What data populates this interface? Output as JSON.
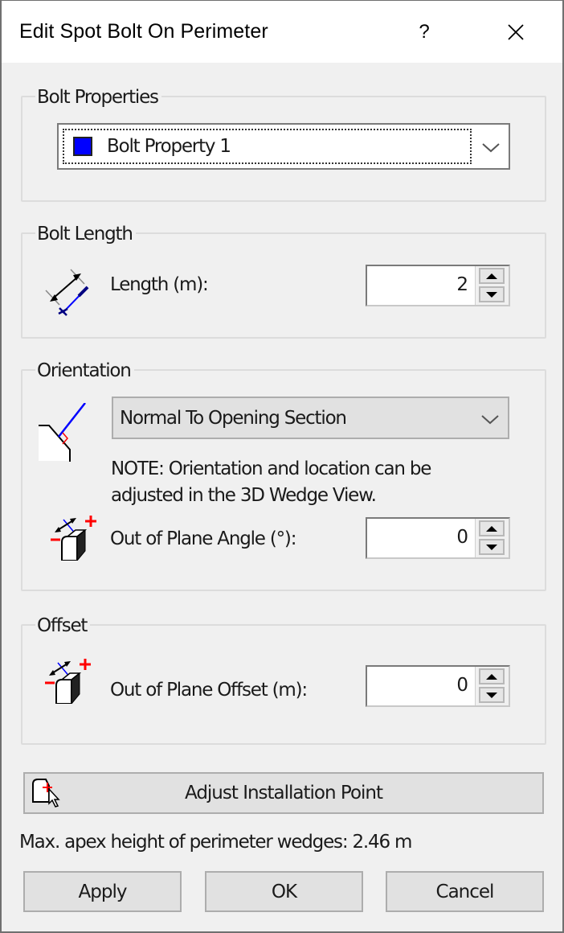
{
  "window": {
    "title": "Edit Spot Bolt On Perimeter",
    "help_label": "?",
    "close_icon": "close-icon"
  },
  "bolt_properties": {
    "group_label": "Bolt Properties",
    "selected": "Bolt Property 1",
    "swatch_color": "#0000ff"
  },
  "bolt_length": {
    "group_label": "Bolt Length",
    "icon": "bolt-length-icon",
    "label": "Length (m):",
    "value": "2"
  },
  "orientation": {
    "group_label": "Orientation",
    "icon": "orientation-normal-icon",
    "selected": "Normal To Opening Section",
    "note_line1": "NOTE: Orientation and location can be",
    "note_line2": "adjusted in the 3D Wedge View.",
    "angle_icon": "out-of-plane-icon",
    "angle_label": "Out of Plane Angle (°):",
    "angle_value": "0"
  },
  "offset": {
    "group_label": "Offset",
    "icon": "out-of-plane-icon",
    "label": "Out of Plane Offset (m):",
    "value": "0"
  },
  "adjust_button": {
    "label": "Adjust Installation Point",
    "icon": "installation-point-cursor-icon"
  },
  "status": {
    "max_apex": "Max. apex height of perimeter wedges: 2.46 m"
  },
  "footer": {
    "apply_label": "Apply",
    "ok_label": "OK",
    "cancel_label": "Cancel"
  }
}
